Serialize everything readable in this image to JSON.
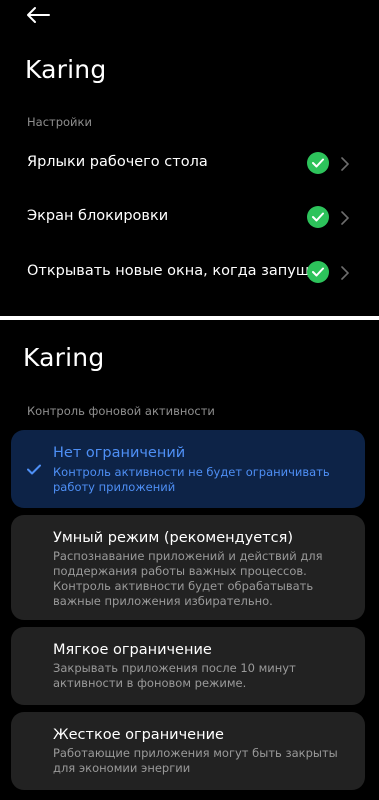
{
  "top": {
    "app_title": "Karing",
    "section_label": "Настройки",
    "rows": [
      {
        "label": "Ярлыки рабочего стола"
      },
      {
        "label": "Экран блокировки"
      },
      {
        "label": "Открывать новые окна, когда запущ.."
      }
    ]
  },
  "bottom": {
    "app_title": "Karing",
    "section_label": "Контроль фоновой активности",
    "options": [
      {
        "title": "Нет ограничений",
        "description": "Контроль активности не будет ограничивать работу приложений",
        "selected": true
      },
      {
        "title": "Умный режим (рекомендуется)",
        "description": "Распознавание приложений и действий для поддержания работы важных процессов. Контроль активности будет обрабатывать важные приложения избирательно.",
        "selected": false
      },
      {
        "title": "Мягкое ограничение",
        "description": "Закрывать приложения после 10 минут активности в фоновом режиме.",
        "selected": false
      },
      {
        "title": "Жесткое ограничение",
        "description": "Работающие приложения могут быть закрыты для экономии энергии",
        "selected": false
      }
    ]
  },
  "colors": {
    "accent": "#4e8ff5",
    "check_green": "#2dc35b",
    "selected_card": "#0d2347",
    "card": "#222222"
  },
  "icons": [
    "back-arrow-icon",
    "check-circle-icon",
    "chevron-right-icon",
    "checkmark-icon"
  ]
}
